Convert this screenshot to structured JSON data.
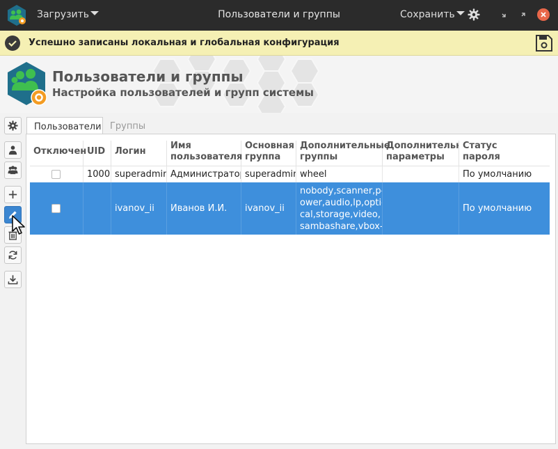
{
  "titlebar": {
    "load_label": "Загрузить",
    "title": "Пользователи и группы",
    "save_label": "Сохранить"
  },
  "notice": {
    "text": "Успешно записаны локальная и глобальная конфигурация"
  },
  "header": {
    "title": "Пользователи и группы",
    "subtitle": "Настройка пользователей и групп системы"
  },
  "left_toolbar": {
    "icons": [
      "gear-icon",
      "user-icon",
      "users-group-icon",
      "plus-icon",
      "pencil-icon",
      "trash-icon",
      "refresh-icon",
      "download-icon"
    ],
    "active": "pencil-icon"
  },
  "tabs": [
    {
      "label": "Пользователи",
      "active": true
    },
    {
      "label": "Группы",
      "active": false
    }
  ],
  "table": {
    "headers": [
      "Отключен",
      "UID",
      "Логин",
      "Имя пользователя",
      "Основная группа",
      "Дополнительные группы",
      "Дополнительные параметры",
      "Статус пароля"
    ],
    "headers_two_line": [
      [
        "Отключен",
        ""
      ],
      [
        "UID",
        ""
      ],
      [
        "Логин",
        ""
      ],
      [
        "Имя",
        "пользователя"
      ],
      [
        "Основная",
        "группа"
      ],
      [
        "Дополнительные",
        "группы"
      ],
      [
        "Дополнительны",
        "параметры"
      ],
      [
        "Статус",
        "пароля"
      ]
    ],
    "rows": [
      {
        "disabled": false,
        "uid": "1000",
        "login": "superadmin",
        "name": "Администратор",
        "primary_group": "superadmin",
        "extra_groups": "wheel",
        "extra_params": "",
        "password_status": "По умолчанию",
        "selected": false
      },
      {
        "disabled": false,
        "uid": "",
        "login": "ivanov_ii",
        "name": "Иванов И.И.",
        "primary_group": "ivanov_ii",
        "extra_groups_lines": [
          "nobody,scanner,p-",
          "ower,audio,lp,opti-",
          "cal,storage,video,",
          "sambashare,vbox-"
        ],
        "extra_params": "",
        "password_status": "По умолчанию",
        "selected": true
      }
    ]
  },
  "colors": {
    "titlebar_bg": "#2b2b2b",
    "notice_bg": "#f5f0b4",
    "selection": "#3e8fdc",
    "close_button": "#e8674a",
    "accent_green": "#3fbf4f",
    "accent_orange": "#f39c23"
  }
}
